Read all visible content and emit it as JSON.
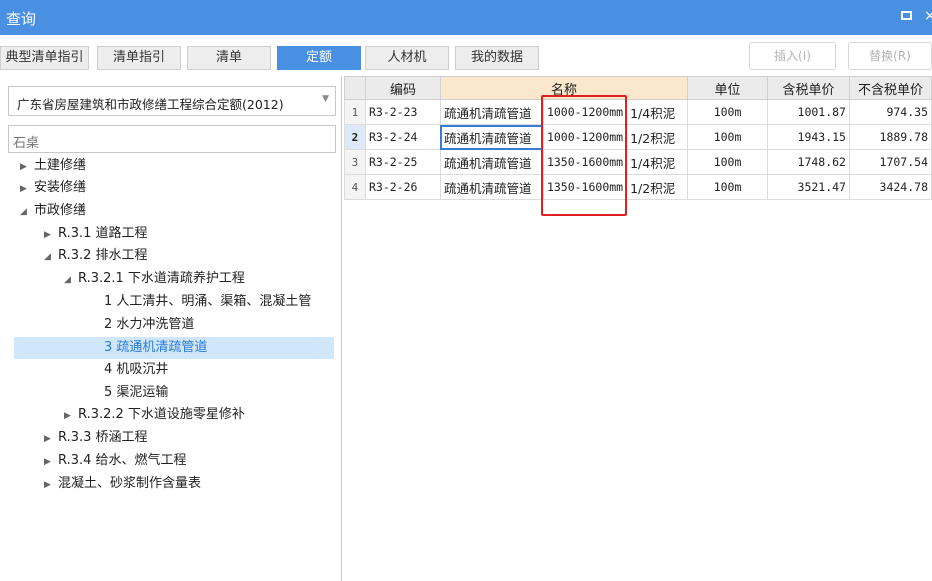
{
  "window": {
    "title": "查询",
    "maximize_glyph": "",
    "close_glyph": "×"
  },
  "tabs": [
    {
      "label": "典型清单指引",
      "active": false
    },
    {
      "label": "清单指引",
      "active": false
    },
    {
      "label": "清单",
      "active": false
    },
    {
      "label": "定额",
      "active": true
    },
    {
      "label": "人材机",
      "active": false
    },
    {
      "label": "我的数据",
      "active": false
    }
  ],
  "actions": {
    "insert_label": "插入(I)",
    "replace_label": "替换(R)"
  },
  "library": {
    "selected": "广东省房屋建筑和市政修缮工程综合定额(2012)"
  },
  "search": {
    "value": "石桌"
  },
  "tree": [
    {
      "label": "土建修缮",
      "arrow": "▶"
    },
    {
      "label": "安装修缮",
      "arrow": "▶"
    },
    {
      "label": "市政修缮",
      "arrow": "◢"
    },
    {
      "label": "R.3.1 道路工程",
      "arrow": "▶"
    },
    {
      "label": "R.3.2 排水工程",
      "arrow": "◢"
    },
    {
      "label": "R.3.2.1 下水道清疏养护工程",
      "arrow": "◢"
    },
    {
      "label": "1 人工清井、明涌、渠箱、混凝土管",
      "arrow": ""
    },
    {
      "label": "2 水力冲洗管道",
      "arrow": ""
    },
    {
      "label": "3 疏通机清疏管道",
      "arrow": ""
    },
    {
      "label": "4 机吸沉井",
      "arrow": ""
    },
    {
      "label": "5 渠泥运输",
      "arrow": ""
    },
    {
      "label": "R.3.2.2 下水道设施零星修补",
      "arrow": "▶"
    },
    {
      "label": "R.3.3 桥涵工程",
      "arrow": "▶"
    },
    {
      "label": "R.3.4 给水、燃气工程",
      "arrow": "▶"
    },
    {
      "label": "混凝土、砂浆制作含量表",
      "arrow": "▶"
    }
  ],
  "table": {
    "headers": {
      "code": "编码",
      "name": "名称",
      "unit": "单位",
      "price_tax": "含税单价",
      "price_notax": "不含税单价"
    },
    "rows": [
      {
        "idx": "1",
        "code": "R3-2-23",
        "name1": "疏通机清疏管道",
        "name2": "1000-1200mm",
        "name3": "1/4积泥",
        "unit": "100m",
        "price_tax": "1001.87",
        "price_notax": "974.35"
      },
      {
        "idx": "2",
        "code": "R3-2-24",
        "name1": "疏通机清疏管道",
        "name2": "1000-1200mm",
        "name3": "1/2积泥",
        "unit": "100m",
        "price_tax": "1943.15",
        "price_notax": "1889.78"
      },
      {
        "idx": "3",
        "code": "R3-2-25",
        "name1": "疏通机清疏管道",
        "name2": "1350-1600mm",
        "name3": "1/4积泥",
        "unit": "100m",
        "price_tax": "1748.62",
        "price_notax": "1707.54"
      },
      {
        "idx": "4",
        "code": "R3-2-26",
        "name1": "疏通机清疏管道",
        "name2": "1350-1600mm",
        "name3": "1/2积泥",
        "unit": "100m",
        "price_tax": "3521.47",
        "price_notax": "3424.78"
      }
    ]
  },
  "colors": {
    "accent": "#4a90e2",
    "highlight": "#cfe6fb",
    "annotation": "#e02020"
  }
}
